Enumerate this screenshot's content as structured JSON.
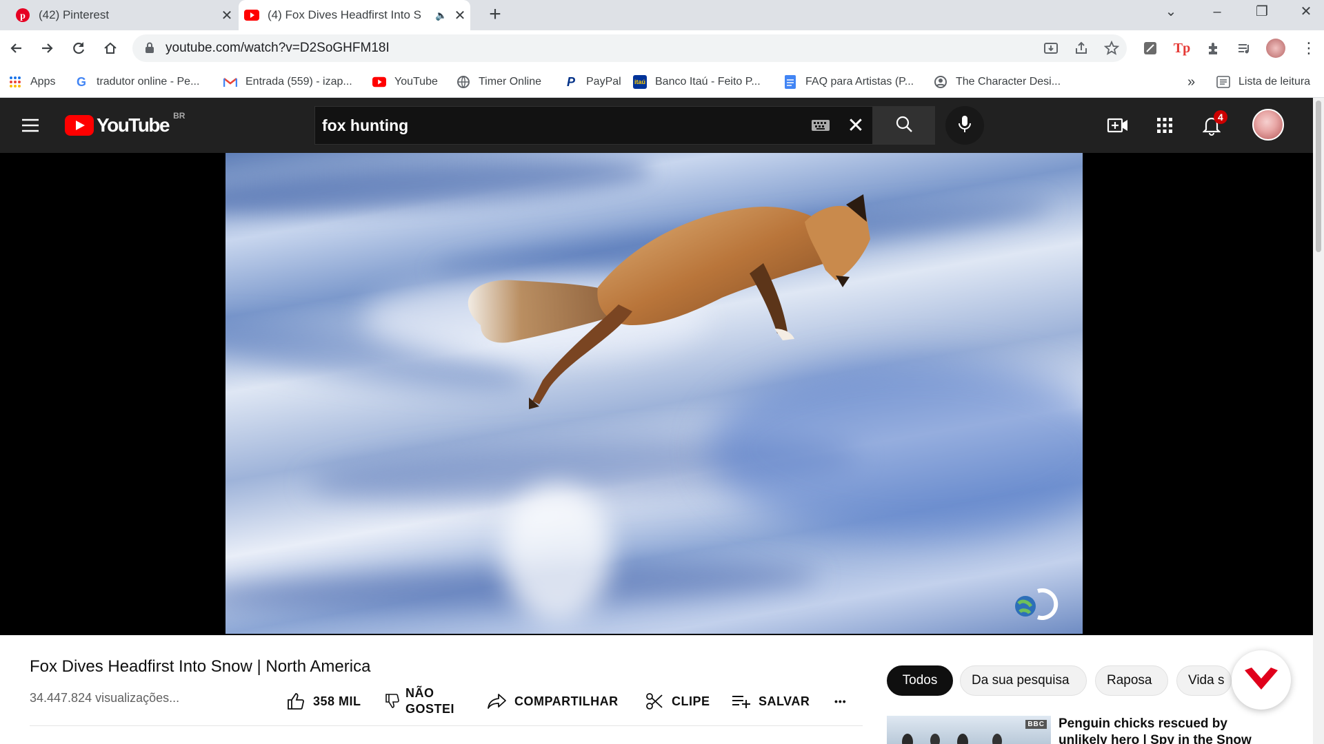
{
  "browser": {
    "tabs": [
      {
        "title": "(42) Pinterest",
        "icon": "pinterest-icon"
      },
      {
        "title": "(4) Fox Dives Headfirst Into S",
        "icon": "youtube-icon",
        "audio": "speaker-icon"
      }
    ],
    "url": "youtube.com/watch?v=D2SoGHFM18I",
    "bookmarks": [
      {
        "label": "Apps",
        "icon": "apps-grid-icon"
      },
      {
        "label": "tradutor online - Pe...",
        "icon": "google-icon"
      },
      {
        "label": "Entrada (559) - izap...",
        "icon": "gmail-icon"
      },
      {
        "label": "YouTube",
        "icon": "youtube-icon"
      },
      {
        "label": "Timer Online",
        "icon": "globe-icon"
      },
      {
        "label": "PayPal",
        "icon": "paypal-icon"
      },
      {
        "label": "Banco Itaú - Feito P...",
        "icon": "itau-icon"
      },
      {
        "label": "FAQ para Artistas (P...",
        "icon": "docs-icon"
      },
      {
        "label": "The Character Desi...",
        "icon": "site-icon"
      }
    ],
    "overflow_label": "»",
    "reading_list": "Lista de leitura"
  },
  "youtube": {
    "logo_text": "YouTube",
    "country_code": "BR",
    "search_query": "fox hunting",
    "notification_count": "4",
    "video": {
      "title": "Fox Dives Headfirst Into Snow | North America",
      "views": "34.447.824 visualizações...",
      "likes": "358 MIL",
      "dislike_line1": "NÃO",
      "dislike_line2": "GOSTEI",
      "share": "COMPARTILHAR",
      "clip": "CLIPE",
      "save": "SALVAR",
      "more": "•••"
    },
    "chips": [
      "Todos",
      "Da sua pesquisa",
      "Raposa",
      "Vida s"
    ],
    "recommendation": {
      "title": "Penguin chicks rescued by unlikely hero | Spy in the Snow",
      "badge": "BBC"
    }
  },
  "colors": {
    "youtube_red": "#ff0000",
    "masthead": "#212121",
    "badge": "#cc0000",
    "vivaldi_red": "#e0001b"
  }
}
